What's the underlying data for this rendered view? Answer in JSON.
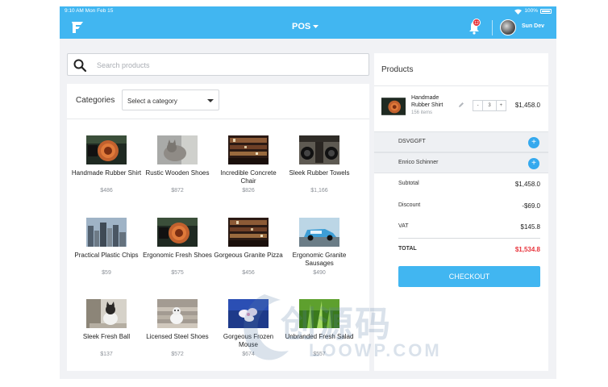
{
  "status_bar": {
    "time_date": "9:10 AM   Mon Feb 15",
    "battery": "100%"
  },
  "app_bar": {
    "title": "POS",
    "notification_count": "12",
    "user_name": "Sun Dev"
  },
  "search": {
    "placeholder": "Search products"
  },
  "catalog": {
    "categories_label": "Categories",
    "category_select": "Select a category",
    "products": [
      {
        "name": "Handmade Rubber Shirt",
        "price": "$486",
        "image": "coil-image"
      },
      {
        "name": "Rustic Wooden Shoes",
        "price": "$872",
        "image": "cat-image"
      },
      {
        "name": "Incredible Concrete Chair",
        "price": "$826",
        "image": "bar-image"
      },
      {
        "name": "Sleek Rubber Towels",
        "price": "$1,166",
        "image": "bottles-image"
      },
      {
        "name": "Practical Plastic Chips",
        "price": "$59",
        "image": "city-image"
      },
      {
        "name": "Ergonomic Fresh Shoes",
        "price": "$575",
        "image": "coil-image"
      },
      {
        "name": "Gorgeous Granite Pizza",
        "price": "$456",
        "image": "bar-image"
      },
      {
        "name": "Ergonomic Granite Sausages",
        "price": "$490",
        "image": "car-image"
      },
      {
        "name": "Sleek Fresh Ball",
        "price": "$137",
        "image": "cat-window-image"
      },
      {
        "name": "Licensed Steel Shoes",
        "price": "$572",
        "image": "cat-stairs-image"
      },
      {
        "name": "Gorgeous Frozen Mouse",
        "price": "$674",
        "image": "orchid-image"
      },
      {
        "name": "Unbranded Fresh Salad",
        "price": "$557",
        "image": "grass-image"
      }
    ]
  },
  "cart": {
    "title": "Products",
    "item": {
      "name": "Handmade Rubber Shirt",
      "count": "156 items",
      "minus": "-",
      "quantity": "3",
      "plus": "+",
      "total": "$1,458.0"
    },
    "customer_bands": [
      {
        "label": "DSVGGFT"
      },
      {
        "label": "Enrico Schinner"
      }
    ],
    "summary": [
      {
        "label": "Subtotal",
        "value": "$1,458.0"
      },
      {
        "label": "Discount",
        "value": "-$69.0"
      },
      {
        "label": "VAT",
        "value": "$145.8"
      }
    ],
    "total": {
      "label": "TOTAL",
      "value": "$1,534.8"
    },
    "checkout_label": "CHECKOUT"
  },
  "watermark": {
    "cn": "创源码",
    "en": "LOOWP.COM"
  },
  "colors": {
    "accent": "#41b6f1",
    "danger": "#e8343c"
  }
}
